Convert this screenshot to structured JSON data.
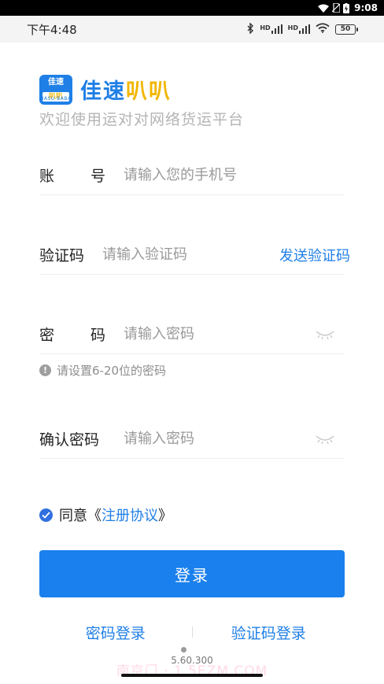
{
  "system_bar": {
    "time": "9:08",
    "icons": [
      "wifi-icon",
      "sim-blocked-icon",
      "battery-charging-icon"
    ]
  },
  "status_bar": {
    "time": "下午4:48",
    "hd1": "HD",
    "hd2": "HD",
    "battery": "50",
    "icons": [
      "bluetooth-icon",
      "signal-icon",
      "signal-icon",
      "wifi-icon",
      "battery-icon"
    ]
  },
  "logo": {
    "mark_top": "佳速",
    "mark_bottom": "叭叭",
    "mark_sub": "JIASU BABA",
    "name_a": "佳速",
    "name_b": "叭叭"
  },
  "subtitle": "欢迎使用运对对网络货运平台",
  "form": {
    "account": {
      "label_chars": [
        "账",
        "号"
      ],
      "placeholder": "请输入您的手机号"
    },
    "code": {
      "label_chars": [
        "验",
        "证",
        "码"
      ],
      "placeholder": "请输入验证码",
      "send_label": "发送验证码"
    },
    "password": {
      "label_chars": [
        "密",
        "码"
      ],
      "placeholder": "请输入密码"
    },
    "hint": "请设置6-20位的密码",
    "confirm": {
      "label": "确认密码",
      "placeholder": "请输入密码"
    }
  },
  "agree": {
    "text": "同意《",
    "link": "注册协议",
    "close": "》",
    "checked": true
  },
  "login_button": "登录",
  "alt_links": {
    "password_login": "密码登录",
    "code_login": "验证码登录"
  },
  "version": "5.60.300",
  "watermark": "南京门 · 1.5EZM.COM",
  "colors": {
    "accent": "#1a80ed",
    "logo_yellow": "#f2b600"
  }
}
